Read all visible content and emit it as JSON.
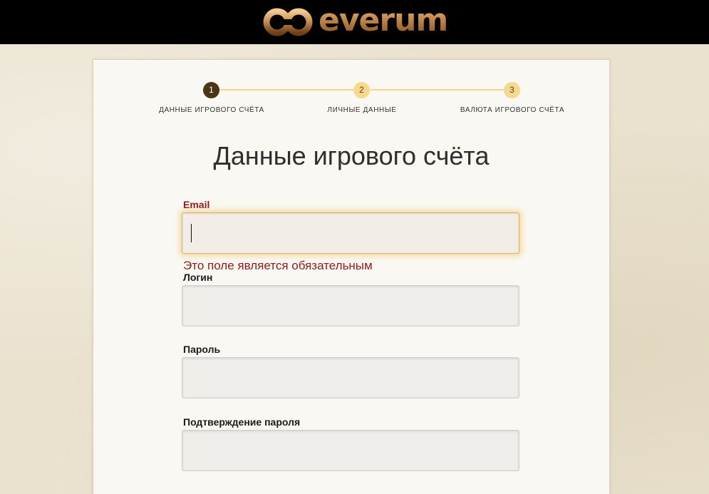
{
  "header": {
    "logo_text": "everum",
    "logo_icon": "everum-logo-mark"
  },
  "steps": [
    {
      "number": "1",
      "label": "ДАННЫЕ ИГРОВОГО СЧЁТА",
      "state": "active"
    },
    {
      "number": "2",
      "label": "ЛИЧНЫЕ ДАННЫЕ",
      "state": "inactive"
    },
    {
      "number": "3",
      "label": "ВАЛЮТА ИГРОВОГО СЧЁТА",
      "state": "inactive"
    }
  ],
  "form": {
    "title": "Данные игрового счёта",
    "fields": [
      {
        "label": "Email",
        "value": "",
        "error": "Это поле является обязательным"
      },
      {
        "label": "Логин",
        "value": ""
      },
      {
        "label": "Пароль",
        "value": ""
      },
      {
        "label": "Подтверждение пароля",
        "value": ""
      }
    ]
  },
  "colors": {
    "accent": "#f2d591",
    "active_step": "#4a3514",
    "error": "#8a1c1c",
    "header_bg": "#000000"
  }
}
